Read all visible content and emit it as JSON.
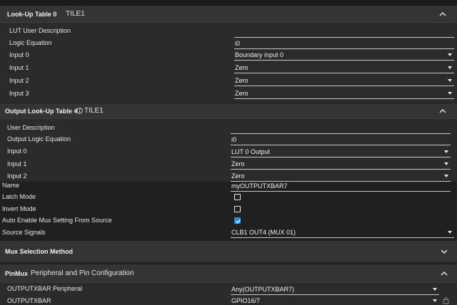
{
  "lut0": {
    "title": "Look-Up Table 0",
    "tile": "TILE1",
    "rows": [
      {
        "label": "LUT User Description",
        "value": ""
      },
      {
        "label": "Logic Equation",
        "value": "i0"
      },
      {
        "label": "Input 0",
        "value": "Boundary input 0"
      },
      {
        "label": "Input 1",
        "value": "Zero"
      },
      {
        "label": "Input 2",
        "value": "Zero"
      },
      {
        "label": "Input 3",
        "value": "Zero"
      }
    ]
  },
  "outlut4": {
    "title": "Output Look-Up Table 4",
    "tile": "TILE1",
    "rows": [
      {
        "label": "User Description",
        "value": ""
      },
      {
        "label": "Output Logic Equation",
        "value": "i0"
      },
      {
        "label": "Input 0",
        "value": "LUT 0 Output"
      },
      {
        "label": "Input 1",
        "value": "Zero"
      },
      {
        "label": "Input 2",
        "value": "Zero"
      }
    ]
  },
  "xbar": {
    "name_label": "Name",
    "name_value": "myOUTPUTXBAR7",
    "latch_label": "Latch Mode",
    "latch_checked": false,
    "invert_label": "Invert Mode",
    "invert_checked": false,
    "auto_label": "Auto Enable Mux Setting From Source",
    "auto_checked": true,
    "source_label": "Source Signals",
    "source_value": "CLB1 OUT4 (MUX 01)"
  },
  "mux": {
    "title": "Mux Selection Method"
  },
  "pinmux": {
    "title": "PinMux",
    "subtitle": "Peripheral and Pin Configuration",
    "rows": [
      {
        "label": "OUTPUTXBAR Peripheral",
        "value": "Any(OUTPUTXBAR7)"
      },
      {
        "label": "OUTPUTXBAR",
        "value": "GPIO16/7"
      }
    ]
  },
  "colors": {
    "accent": "#2b8de0",
    "panel": "#2b2b2b",
    "header": "#343434"
  },
  "icons": [
    "chevron-up-icon",
    "chevron-down-icon",
    "info-icon",
    "lock-icon",
    "dropdown-arrow-icon",
    "checkmark-icon"
  ]
}
